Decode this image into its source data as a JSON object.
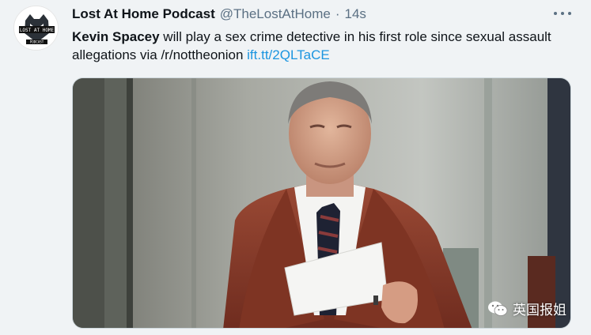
{
  "tweet": {
    "author_name": "Lost At Home Podcast",
    "author_handle": "@TheLostAtHome",
    "separator": "·",
    "timestamp": "14s",
    "avatar_text": [
      "LOST AT HOME",
      "PODCAST"
    ],
    "more_icon": "more-horizontal-icon",
    "text_bold": "Kevin Spacey",
    "text_body": " will play a sex crime detective in his first role since sexual assault allegations via /r/nottheonion ",
    "link_text": "ift.tt/2QLTaCE"
  },
  "watermark": {
    "text": "英国报姐",
    "icon": "wechat-icon"
  },
  "colors": {
    "background": "#f0f3f5",
    "link": "#1b95e0",
    "secondary_text": "#5b7083",
    "suit": "#8b3b2a"
  }
}
